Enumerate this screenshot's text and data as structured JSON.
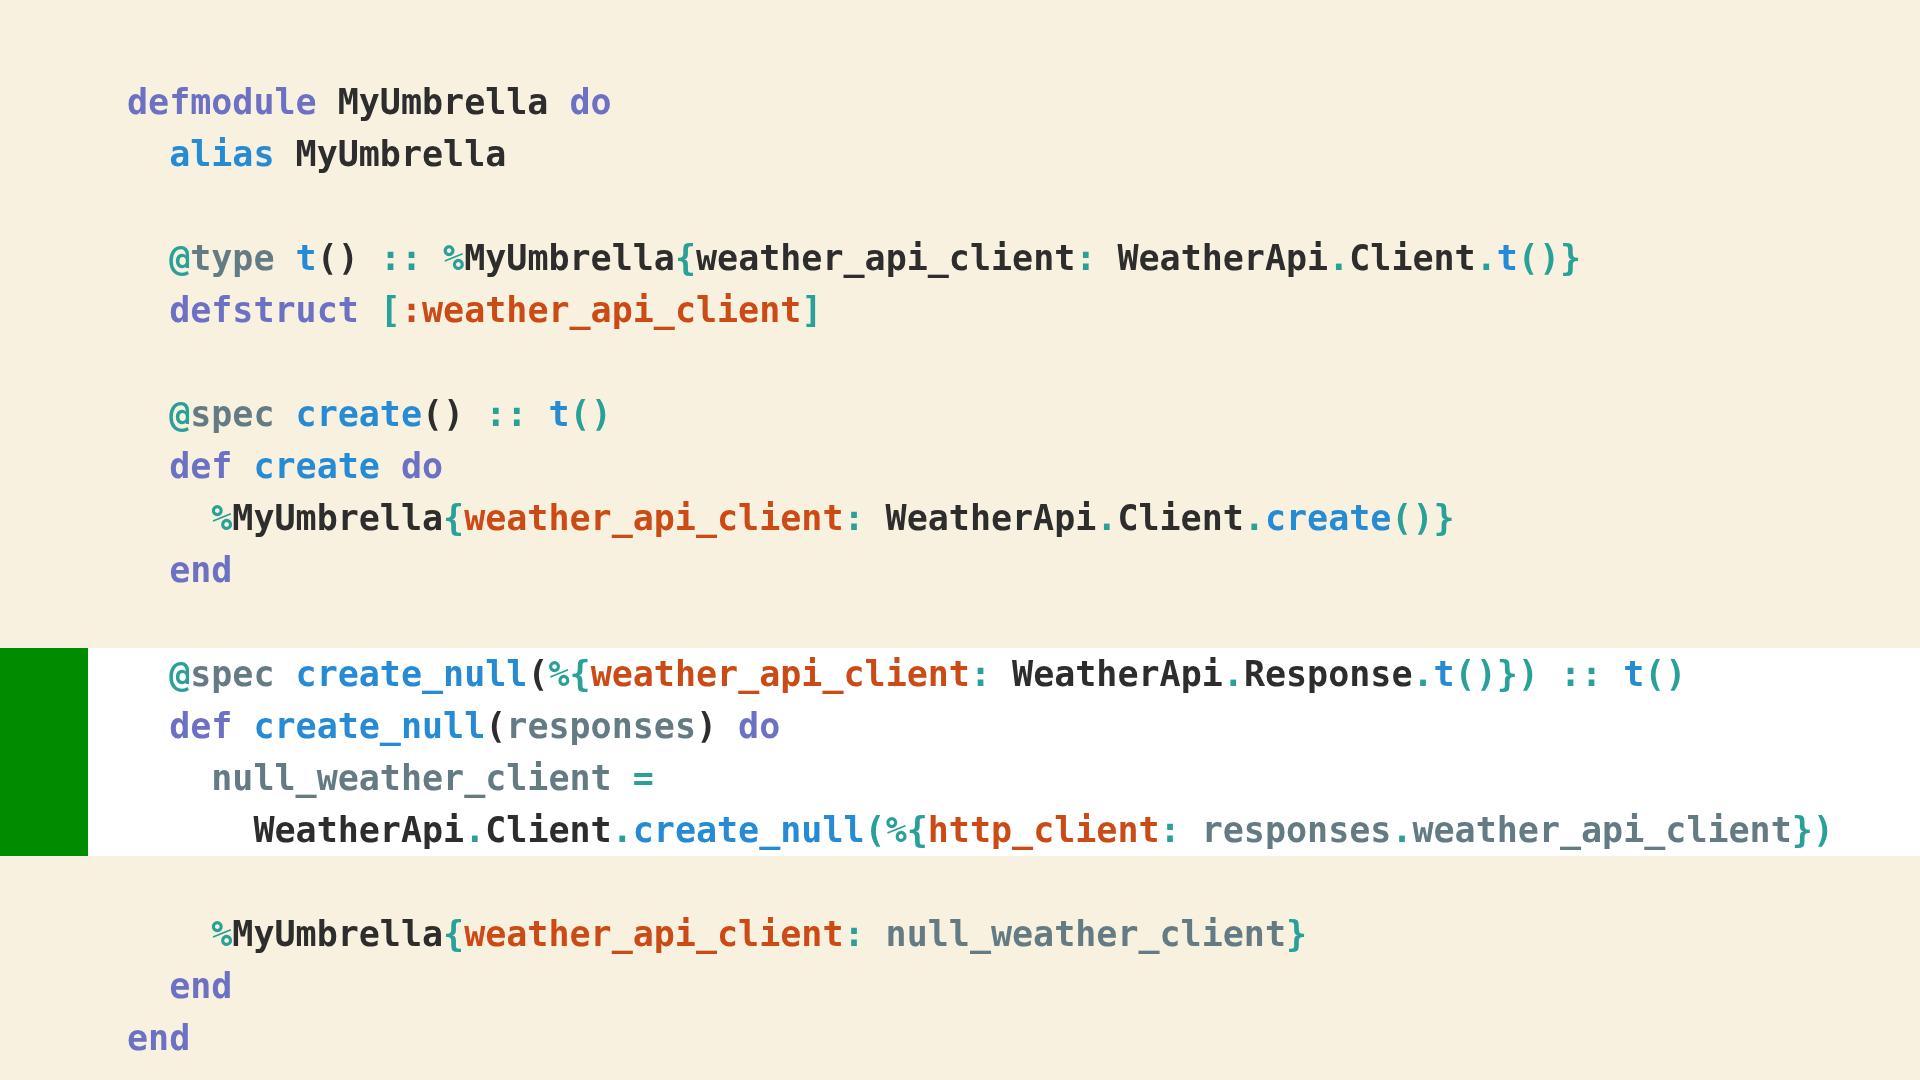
{
  "code_lines": [
    {
      "highlighted": false,
      "tokens": [
        {
          "text": "defmodule",
          "kind": "keyword"
        },
        {
          "text": " MyUmbrella",
          "kind": "module"
        },
        {
          "text": " do",
          "kind": "keyword"
        }
      ]
    },
    {
      "highlighted": false,
      "tokens": [
        {
          "text": "  alias",
          "kind": "function"
        },
        {
          "text": " MyUmbrella",
          "kind": "module"
        }
      ]
    },
    {
      "highlighted": false
    },
    {
      "highlighted": false,
      "tokens": [
        {
          "text": "  @",
          "kind": "punct"
        },
        {
          "text": "type",
          "kind": "variable"
        },
        {
          "text": " t",
          "kind": "function"
        },
        {
          "text": "()",
          "kind": "module"
        },
        {
          "text": " :: %",
          "kind": "punct"
        },
        {
          "text": "MyUmbrella",
          "kind": "module"
        },
        {
          "text": "{",
          "kind": "punct"
        },
        {
          "text": "weather_api_client",
          "kind": "module"
        },
        {
          "text": ":",
          "kind": "punct"
        },
        {
          "text": " WeatherApi",
          "kind": "module"
        },
        {
          "text": ".",
          "kind": "punct"
        },
        {
          "text": "Client",
          "kind": "module"
        },
        {
          "text": ".",
          "kind": "punct"
        },
        {
          "text": "t",
          "kind": "function"
        },
        {
          "text": "()}",
          "kind": "punct"
        }
      ]
    },
    {
      "highlighted": false,
      "tokens": [
        {
          "text": "  defstruct",
          "kind": "keyword"
        },
        {
          "text": " [",
          "kind": "punct"
        },
        {
          "text": ":weather_api_client",
          "kind": "atom"
        },
        {
          "text": "]",
          "kind": "punct"
        }
      ]
    },
    {
      "highlighted": false
    },
    {
      "highlighted": false,
      "tokens": [
        {
          "text": "  @",
          "kind": "punct"
        },
        {
          "text": "spec",
          "kind": "variable"
        },
        {
          "text": " create",
          "kind": "function"
        },
        {
          "text": "()",
          "kind": "module"
        },
        {
          "text": " :: ",
          "kind": "punct"
        },
        {
          "text": "t",
          "kind": "function"
        },
        {
          "text": "()",
          "kind": "punct"
        }
      ]
    },
    {
      "highlighted": false,
      "tokens": [
        {
          "text": "  def",
          "kind": "keyword"
        },
        {
          "text": " create",
          "kind": "function"
        },
        {
          "text": " do",
          "kind": "keyword"
        }
      ]
    },
    {
      "highlighted": false,
      "tokens": [
        {
          "text": "    %",
          "kind": "punct"
        },
        {
          "text": "MyUmbrella",
          "kind": "module"
        },
        {
          "text": "{",
          "kind": "punct"
        },
        {
          "text": "weather_api_client",
          "kind": "atom"
        },
        {
          "text": ":",
          "kind": "punct"
        },
        {
          "text": " WeatherApi",
          "kind": "module"
        },
        {
          "text": ".",
          "kind": "punct"
        },
        {
          "text": "Client",
          "kind": "module"
        },
        {
          "text": ".",
          "kind": "punct"
        },
        {
          "text": "create",
          "kind": "function"
        },
        {
          "text": "()}",
          "kind": "punct"
        }
      ]
    },
    {
      "highlighted": false,
      "tokens": [
        {
          "text": "  end",
          "kind": "keyword"
        }
      ]
    },
    {
      "highlighted": false
    },
    {
      "highlighted": true,
      "tokens": [
        {
          "text": "  @",
          "kind": "punct"
        },
        {
          "text": "spec",
          "kind": "variable"
        },
        {
          "text": " create_null",
          "kind": "function"
        },
        {
          "text": "(",
          "kind": "module"
        },
        {
          "text": "%{",
          "kind": "punct"
        },
        {
          "text": "weather_api_client",
          "kind": "atom"
        },
        {
          "text": ":",
          "kind": "punct"
        },
        {
          "text": " WeatherApi",
          "kind": "module"
        },
        {
          "text": ".",
          "kind": "punct"
        },
        {
          "text": "Response",
          "kind": "module"
        },
        {
          "text": ".",
          "kind": "punct"
        },
        {
          "text": "t",
          "kind": "function"
        },
        {
          "text": "()})",
          "kind": "punct"
        },
        {
          "text": " :: ",
          "kind": "punct"
        },
        {
          "text": "t",
          "kind": "function"
        },
        {
          "text": "()",
          "kind": "punct"
        }
      ]
    },
    {
      "highlighted": true,
      "tokens": [
        {
          "text": "  def",
          "kind": "keyword"
        },
        {
          "text": " create_null",
          "kind": "function"
        },
        {
          "text": "(",
          "kind": "module"
        },
        {
          "text": "responses",
          "kind": "variable"
        },
        {
          "text": ")",
          "kind": "module"
        },
        {
          "text": " do",
          "kind": "keyword"
        }
      ]
    },
    {
      "highlighted": true,
      "tokens": [
        {
          "text": "    null_weather_client",
          "kind": "variable"
        },
        {
          "text": " =",
          "kind": "punct"
        }
      ]
    },
    {
      "highlighted": true,
      "tokens": [
        {
          "text": "      WeatherApi",
          "kind": "module"
        },
        {
          "text": ".",
          "kind": "punct"
        },
        {
          "text": "Client",
          "kind": "module"
        },
        {
          "text": ".",
          "kind": "punct"
        },
        {
          "text": "create_null",
          "kind": "function"
        },
        {
          "text": "(",
          "kind": "punct"
        },
        {
          "text": "%{",
          "kind": "punct"
        },
        {
          "text": "http_client",
          "kind": "atom"
        },
        {
          "text": ":",
          "kind": "punct"
        },
        {
          "text": " responses",
          "kind": "variable"
        },
        {
          "text": ".",
          "kind": "punct"
        },
        {
          "text": "weather_api_client",
          "kind": "variable"
        },
        {
          "text": "})",
          "kind": "punct"
        }
      ]
    },
    {
      "highlighted": false
    },
    {
      "highlighted": false,
      "tokens": [
        {
          "text": "    %",
          "kind": "punct"
        },
        {
          "text": "MyUmbrella",
          "kind": "module"
        },
        {
          "text": "{",
          "kind": "punct"
        },
        {
          "text": "weather_api_client",
          "kind": "atom"
        },
        {
          "text": ":",
          "kind": "punct"
        },
        {
          "text": " null_weather_client",
          "kind": "variable"
        },
        {
          "text": "}",
          "kind": "punct"
        }
      ]
    },
    {
      "highlighted": false,
      "tokens": [
        {
          "text": "  end",
          "kind": "keyword"
        }
      ]
    },
    {
      "highlighted": false,
      "tokens": [
        {
          "text": "end",
          "kind": "keyword"
        }
      ]
    }
  ]
}
